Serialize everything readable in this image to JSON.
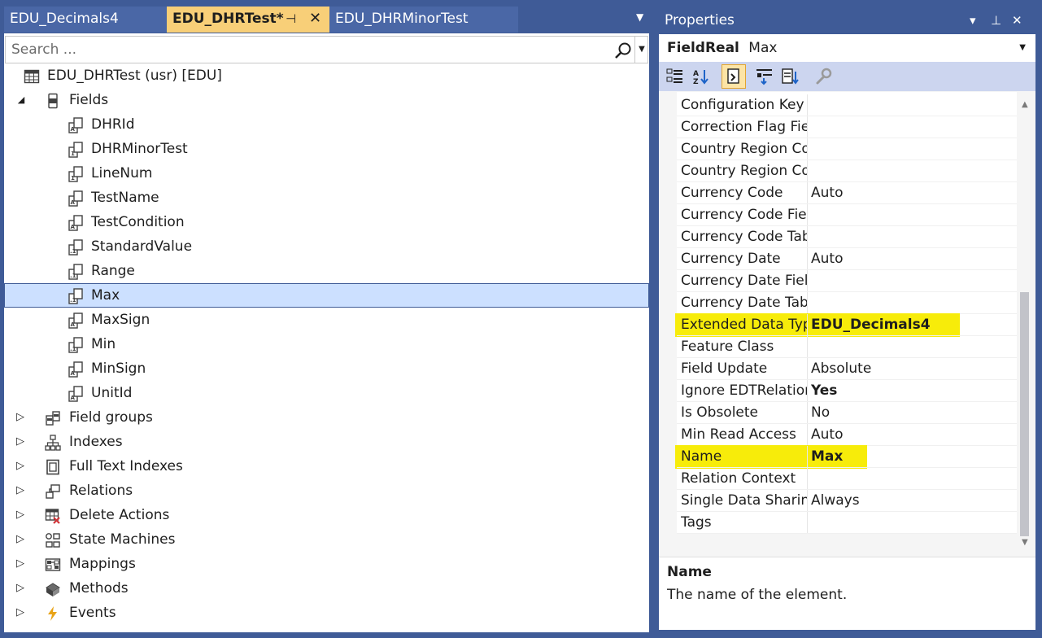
{
  "tabs": [
    {
      "label": "EDU_Decimals4"
    },
    {
      "label": "EDU_DHRTest*",
      "pin": "⊣",
      "close": "✕"
    },
    {
      "label": "EDU_DHRMinorTest"
    }
  ],
  "search": {
    "placeholder": "Search ..."
  },
  "tree": {
    "root": {
      "label": "EDU_DHRTest (usr) [EDU]",
      "icon": "table-icon"
    },
    "fields_node": {
      "label": "Fields",
      "icon": "fields-icon",
      "toggle": "◢"
    },
    "fields": [
      {
        "label": "DHRId",
        "icon": "field-string-icon"
      },
      {
        "label": "DHRMinorTest",
        "icon": "field-int-icon"
      },
      {
        "label": "LineNum",
        "icon": "field-int-icon"
      },
      {
        "label": "TestName",
        "icon": "field-string-icon"
      },
      {
        "label": "TestCondition",
        "icon": "field-string-icon"
      },
      {
        "label": "StandardValue",
        "icon": "field-real-icon"
      },
      {
        "label": "Range",
        "icon": "field-real-icon"
      },
      {
        "label": "Max",
        "icon": "field-real-icon",
        "selected": true
      },
      {
        "label": "MaxSign",
        "icon": "field-string-icon"
      },
      {
        "label": "Min",
        "icon": "field-real-icon"
      },
      {
        "label": "MinSign",
        "icon": "field-string-icon"
      },
      {
        "label": "UnitId",
        "icon": "field-string-icon"
      }
    ],
    "nodes": [
      {
        "label": "Field groups",
        "icon": "field-groups-icon",
        "toggle": "▷"
      },
      {
        "label": "Indexes",
        "icon": "indexes-icon",
        "toggle": "▷"
      },
      {
        "label": "Full Text Indexes",
        "icon": "full-text-indexes-icon",
        "toggle": "▷"
      },
      {
        "label": "Relations",
        "icon": "relations-icon",
        "toggle": "▷"
      },
      {
        "label": "Delete Actions",
        "icon": "delete-actions-icon",
        "toggle": "▷"
      },
      {
        "label": "State Machines",
        "icon": "state-machines-icon",
        "toggle": "▷"
      },
      {
        "label": "Mappings",
        "icon": "mappings-icon",
        "toggle": "▷"
      },
      {
        "label": "Methods",
        "icon": "methods-icon",
        "toggle": "▷"
      },
      {
        "label": "Events",
        "icon": "events-icon",
        "toggle": "▷"
      }
    ]
  },
  "properties": {
    "title": "Properties",
    "object_type": "FieldReal",
    "object_name": "Max",
    "rows": [
      {
        "name": "Configuration Key",
        "value": ""
      },
      {
        "name": "Correction Flag Field",
        "value": ""
      },
      {
        "name": "Country Region Codes",
        "value": ""
      },
      {
        "name": "Country Region Context",
        "value": ""
      },
      {
        "name": "Currency Code",
        "value": "Auto"
      },
      {
        "name": "Currency Code Field",
        "value": ""
      },
      {
        "name": "Currency Code Table",
        "value": ""
      },
      {
        "name": "Currency Date",
        "value": "Auto"
      },
      {
        "name": "Currency Date Field",
        "value": ""
      },
      {
        "name": "Currency Date Table",
        "value": ""
      },
      {
        "name": "Extended Data Type",
        "value": "EDU_Decimals4",
        "bold": true,
        "highlight": true
      },
      {
        "name": "Feature Class",
        "value": ""
      },
      {
        "name": "Field Update",
        "value": "Absolute"
      },
      {
        "name": "Ignore EDTRelation",
        "value": "Yes",
        "bold": true
      },
      {
        "name": "Is Obsolete",
        "value": "No"
      },
      {
        "name": "Min Read Access",
        "value": "Auto"
      },
      {
        "name": "Name",
        "value": "Max",
        "bold": true,
        "highlight": true
      },
      {
        "name": "Relation Context",
        "value": ""
      },
      {
        "name": "Single Data Sharing",
        "value": "Always"
      },
      {
        "name": "Tags",
        "value": ""
      }
    ],
    "description": {
      "title": "Name",
      "text": "The name of the element."
    },
    "highlight_color": "#f7ec0a"
  }
}
